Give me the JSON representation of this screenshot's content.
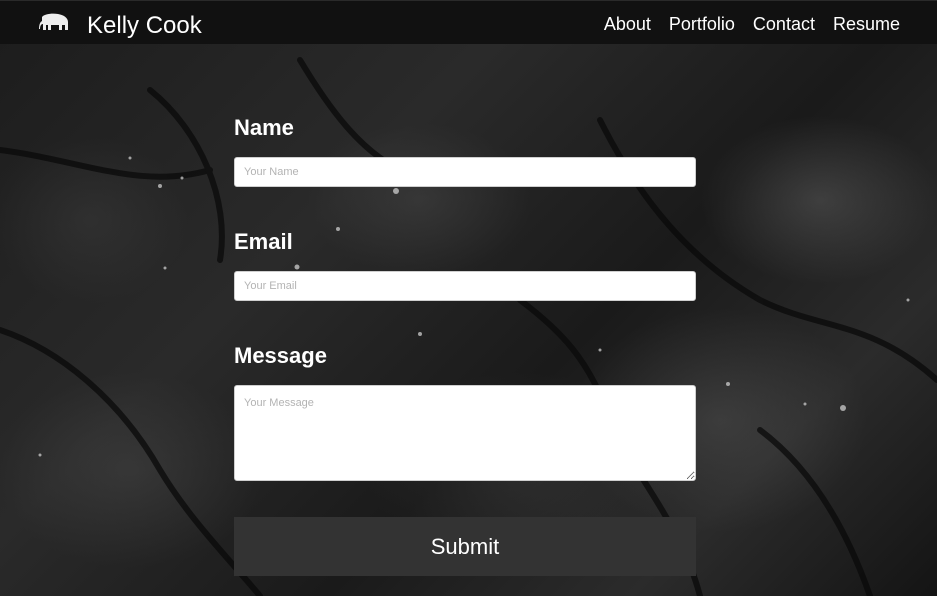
{
  "brand": {
    "name": "Kelly Cook",
    "icon": "elephant-icon"
  },
  "nav": {
    "links": [
      "About",
      "Portfolio",
      "Contact",
      "Resume"
    ]
  },
  "form": {
    "name": {
      "label": "Name",
      "placeholder": "Your Name"
    },
    "email": {
      "label": "Email",
      "placeholder": "Your Email"
    },
    "message": {
      "label": "Message",
      "placeholder": "Your Message"
    },
    "submit": "Submit"
  },
  "colors": {
    "navbar": "#111111",
    "button": "#333333",
    "text": "#ffffff"
  }
}
